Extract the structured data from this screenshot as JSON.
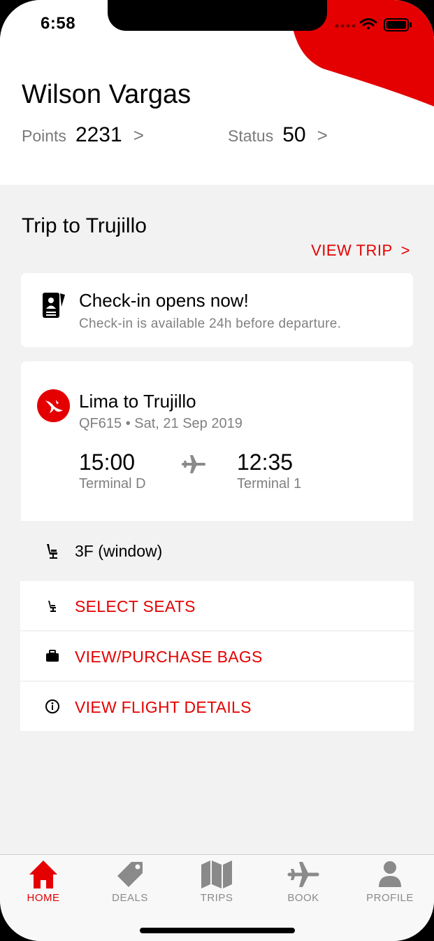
{
  "status_bar": {
    "time": "6:58"
  },
  "profile": {
    "name": "Wilson Vargas",
    "points_label": "Points",
    "points_value": "2231",
    "status_label": "Status",
    "status_value": "50",
    "chevron": ">"
  },
  "trip": {
    "title": "Trip to Trujillo",
    "view_trip_label": "VIEW TRIP",
    "view_trip_chevron": ">"
  },
  "checkin": {
    "title": "Check-in opens now!",
    "subtitle": "Check-in is available 24h before departure."
  },
  "flight": {
    "route": "Lima to Trujillo",
    "meta": "QF615 • Sat, 21 Sep 2019",
    "departure_time": "15:00",
    "departure_terminal": "Terminal D",
    "arrival_time": "12:35",
    "arrival_terminal": "Terminal 1",
    "seat": "3F (window)"
  },
  "actions": [
    {
      "label": "SELECT SEATS",
      "icon": "seat-icon"
    },
    {
      "label": "VIEW/PURCHASE BAGS",
      "icon": "briefcase-icon"
    },
    {
      "label": "VIEW FLIGHT DETAILS",
      "icon": "info-icon"
    }
  ],
  "tabs": [
    {
      "label": "HOME",
      "icon": "home-icon",
      "active": true
    },
    {
      "label": "DEALS",
      "icon": "tag-icon",
      "active": false
    },
    {
      "label": "TRIPS",
      "icon": "map-icon",
      "active": false
    },
    {
      "label": "BOOK",
      "icon": "plane-icon",
      "active": false
    },
    {
      "label": "PROFILE",
      "icon": "person-icon",
      "active": false
    }
  ],
  "colors": {
    "accent": "#e40000",
    "background": "#f2f2f2",
    "muted": "#808080"
  }
}
